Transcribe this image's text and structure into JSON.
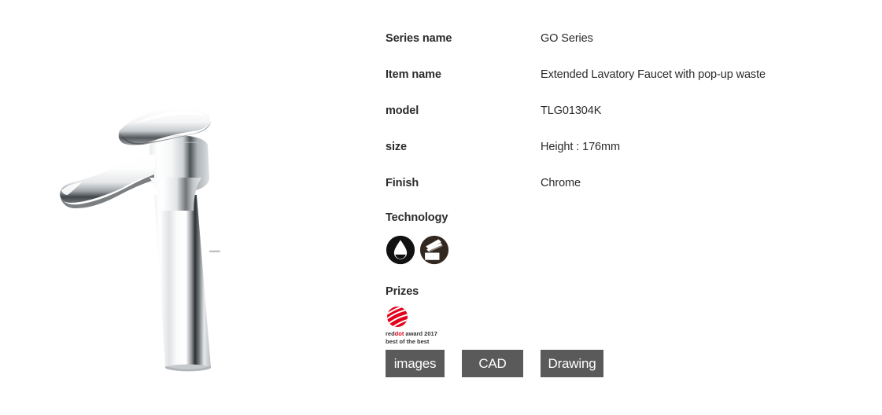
{
  "product_image": {
    "alt": "Chrome extended lavatory faucet, single lever",
    "name": "faucet-product-image"
  },
  "spec_rows": [
    {
      "label": "Series name",
      "value": "GO Series"
    },
    {
      "label": "Item name",
      "value": "Extended Lavatory Faucet with pop-up waste"
    },
    {
      "label": "model",
      "value": "TLG01304K"
    },
    {
      "label": "size",
      "value": "Height : 176mm"
    },
    {
      "label": "Finish",
      "value": "Chrome"
    }
  ],
  "technology": {
    "heading": "Technology",
    "icons": [
      {
        "name": "water-drop-icon",
        "title": "water saving drop"
      },
      {
        "name": "easy-clean-surface-icon",
        "title": "easy clean surface"
      }
    ]
  },
  "prizes": {
    "heading": "Prizes",
    "award": {
      "name": "reddot-award-logo",
      "text_red": "red",
      "text_dot": "dot",
      "text_rest": " award 2017",
      "line2": "best of the best"
    }
  },
  "buttons": [
    {
      "label": "images",
      "name": "images-button"
    },
    {
      "label": "CAD",
      "name": "cad-button"
    },
    {
      "label": "Drawing",
      "name": "drawing-button"
    }
  ],
  "colors": {
    "button_bg": "#5a5a5a",
    "button_text": "#ffffff",
    "text": "#2b2b2b",
    "reddot_red": "#e2001a",
    "icon_black": "#111111",
    "page_bg": "#ffffff"
  }
}
